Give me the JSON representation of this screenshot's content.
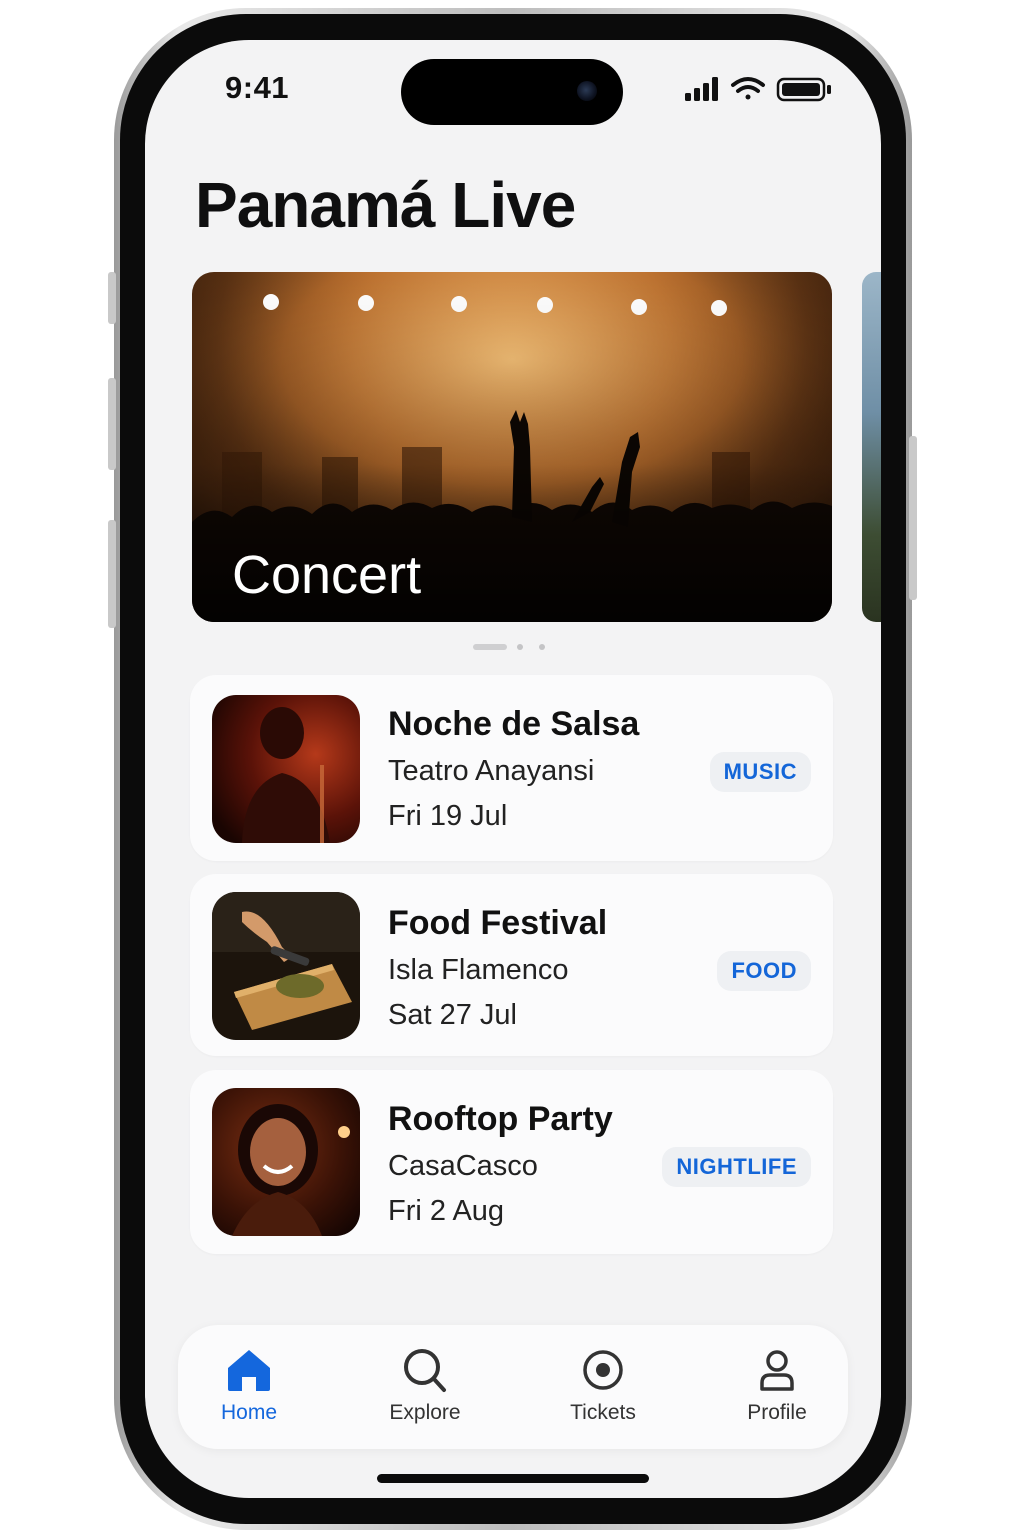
{
  "status_bar": {
    "time": "9:41"
  },
  "app": {
    "title": "Panamá Live"
  },
  "hero": {
    "label": "Concert",
    "page_count": 3,
    "active_page": 1
  },
  "events": [
    {
      "title": "Noche de Salsa",
      "venue": "Teatro Anayansi",
      "date": "Fri 19 Jul",
      "tag": "MUSIC"
    },
    {
      "title": "Food Festival",
      "venue": "Isla Flamenco",
      "date": "Sat 27 Jul",
      "tag": "FOOD"
    },
    {
      "title": "Rooftop Party",
      "venue": "CasaCasco",
      "date": "Fri 2 Aug",
      "tag": "NIGHTLIFE"
    }
  ],
  "tabbar": {
    "tabs": [
      {
        "label": "Home",
        "icon": "home-icon",
        "active": true
      },
      {
        "label": "Explore",
        "icon": "search-icon",
        "active": false
      },
      {
        "label": "Tickets",
        "icon": "ticket-icon",
        "active": false
      },
      {
        "label": "Profile",
        "icon": "person-icon",
        "active": false
      }
    ]
  },
  "colors": {
    "accent": "#1467dd",
    "tag_text": "#1466d8",
    "tag_bg": "#eef0f3",
    "screen_bg": "#f3f3f4"
  }
}
